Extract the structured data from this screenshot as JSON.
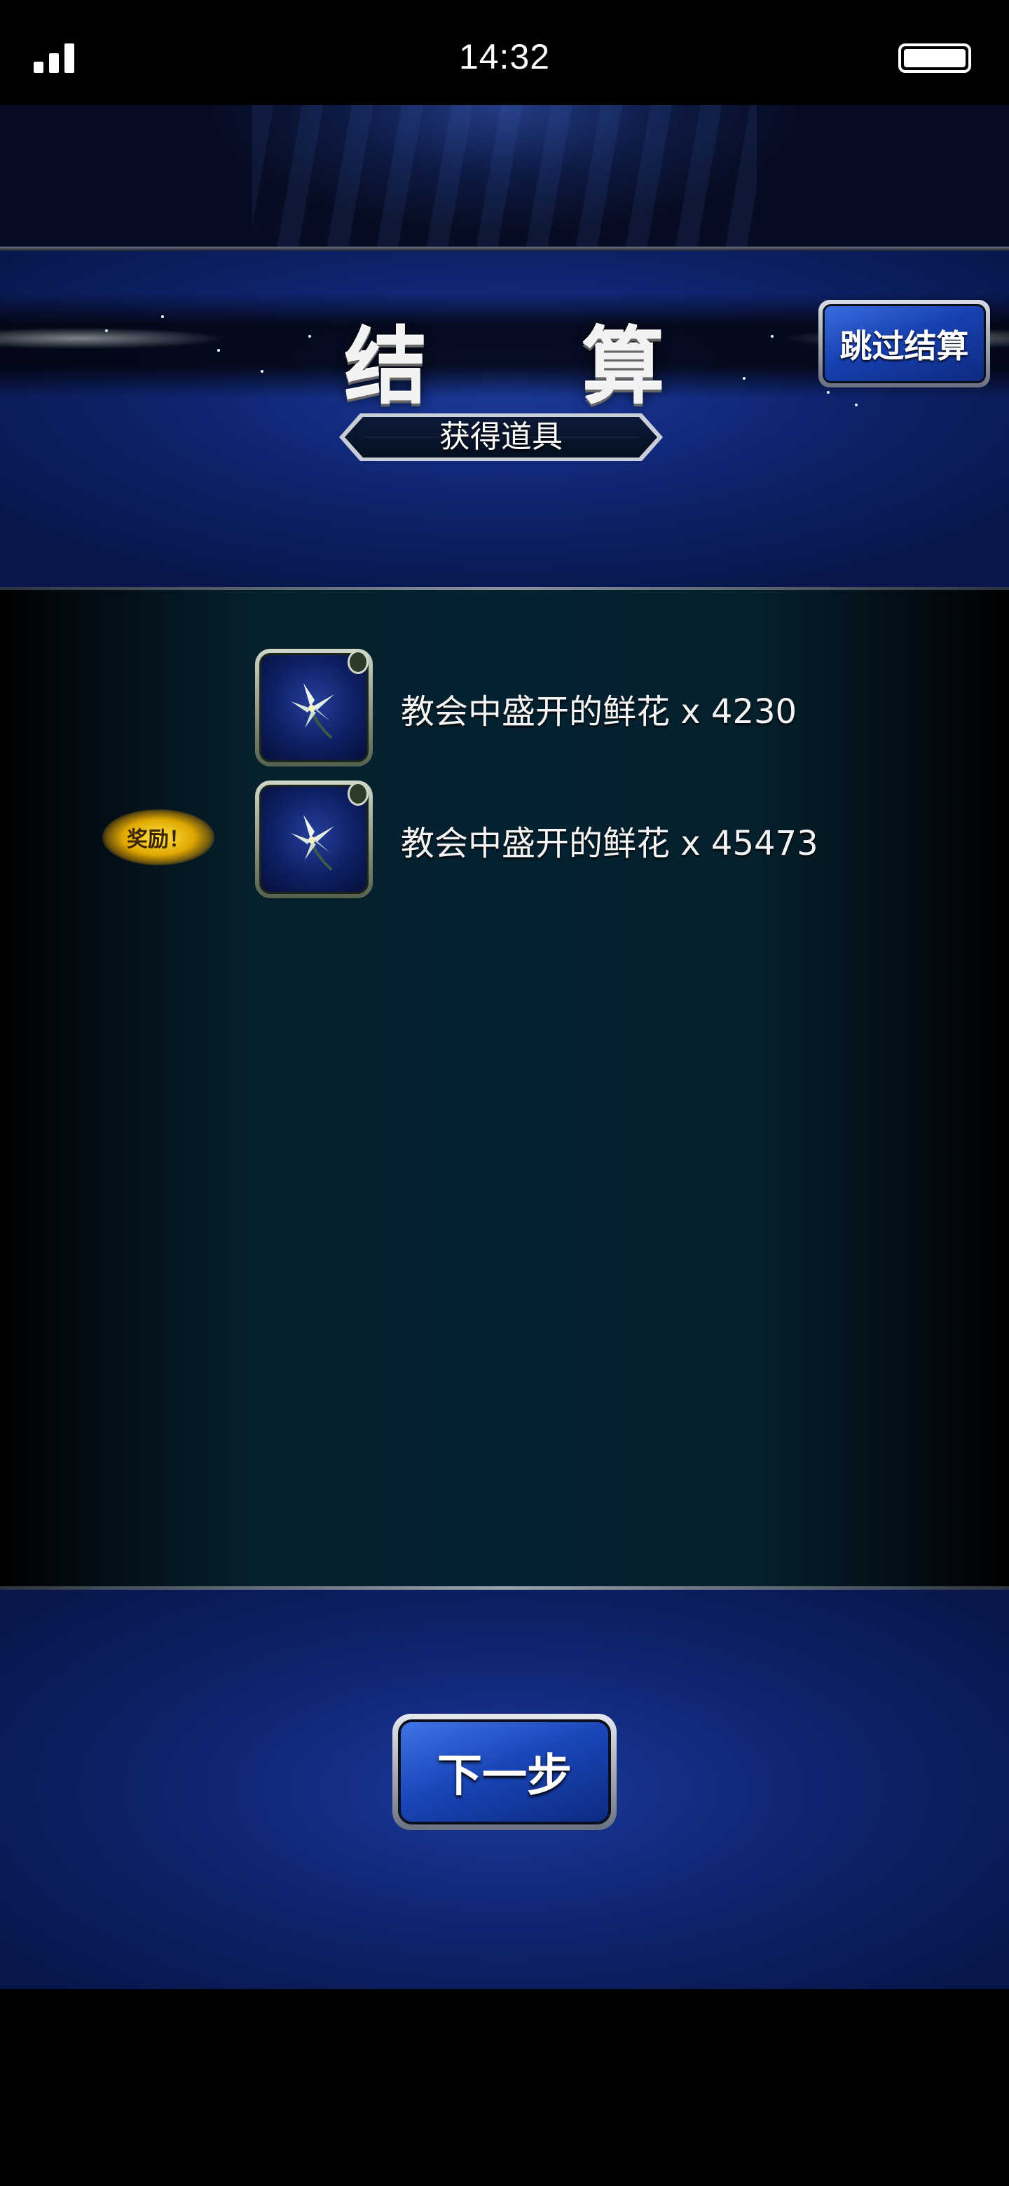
{
  "status_bar": {
    "time": "14:32"
  },
  "header": {
    "title": "结 算",
    "skip_label": "跳过结算",
    "subtitle": "获得道具"
  },
  "items": [
    {
      "text": "教会中盛开的鲜花 x 4230",
      "icon": "white-lily-icon"
    },
    {
      "text": "教会中盛开的鲜花 x 45473",
      "icon": "white-lily-icon"
    }
  ],
  "reward_badge": "奖励！",
  "next_label": "下一步",
  "colors": {
    "accent_blue": "#1a46b8",
    "background_panel": "#052231",
    "badge_gold": "#e0a800"
  }
}
